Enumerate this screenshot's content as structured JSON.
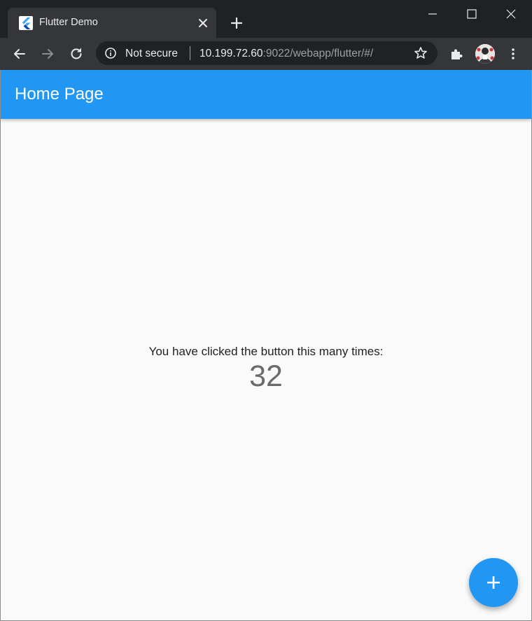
{
  "browser": {
    "tab": {
      "title": "Flutter Demo",
      "favicon": "flutter-logo-icon"
    },
    "window_controls": [
      "minimize-icon",
      "maximize-icon",
      "close-icon"
    ],
    "address_bar": {
      "security_label": "Not secure",
      "url_host": "10.199.72.60",
      "url_rest": ":9022/webapp/flutter/#/"
    },
    "icons": [
      "back-arrow-icon",
      "forward-arrow-icon",
      "reload-icon",
      "info-icon",
      "star-icon",
      "extensions-icon",
      "profile-avatar",
      "more-menu-icon"
    ]
  },
  "app": {
    "appbar_title": "Home Page",
    "counter_label": "You have clicked the button this many times:",
    "counter_value": "32",
    "fab_icon": "plus-icon",
    "colors": {
      "primary": "#2196f3",
      "background": "#fafafa"
    }
  }
}
